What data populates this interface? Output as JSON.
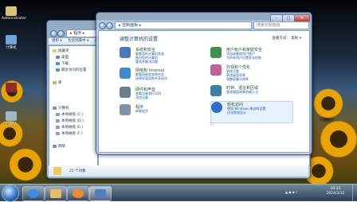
{
  "desktop": {
    "icons": [
      {
        "label": "Administrator",
        "color": "#d9c27a"
      },
      {
        "label": "计算机",
        "color": "#6fa5d8"
      },
      {
        "label": "",
        "color": "#8e2b2b"
      },
      {
        "label": "回收站",
        "color": "#9fb8c8"
      }
    ]
  },
  "explorer": {
    "address": "▸ 程序 ▸",
    "search_placeholder": "搜索",
    "toolbar": [
      "组织 ▾",
      "包含到库中 ▾",
      "共享 ▾",
      "新建文件夹"
    ],
    "tree": [
      {
        "label": "收藏夹",
        "color": "#f2c45a"
      },
      {
        "label": "桌面",
        "color": "#5b8ed0"
      },
      {
        "label": "下载",
        "color": "#5b8ed0"
      },
      {
        "label": "最近访问的位置",
        "color": "#5b8ed0"
      },
      {
        "label": "",
        "color": "#ffffff"
      },
      {
        "label": "库",
        "color": "#e0b050"
      },
      {
        "label": "",
        "color": "#ffffff"
      },
      {
        "label": "计算机",
        "color": "#6f95c0"
      },
      {
        "label": "本地磁盘 (C:)",
        "color": "#8aa0b8"
      },
      {
        "label": "本地磁盘 (D:)",
        "color": "#8aa0b8"
      },
      {
        "label": "本地磁盘 (E:)",
        "color": "#8aa0b8"
      },
      {
        "label": "本地磁盘 (F:)",
        "color": "#8aa0b8"
      },
      {
        "label": "",
        "color": "#ffffff"
      },
      {
        "label": "网络",
        "color": "#6f95c0"
      }
    ],
    "status": "25 个对象"
  },
  "control_panel": {
    "address": "▸ 控制面板 ▸",
    "search_placeholder": "搜索控制面板",
    "heading": "调整计算机的设置",
    "view_by": "查看方式： 类别 ▾",
    "categories": [
      {
        "title": "系统和安全",
        "links": [
          "查看您的计算机状态",
          "备份您的计算机",
          "查找并解决问题"
        ],
        "color": "#4a78b8"
      },
      {
        "title": "网络和 Internet",
        "links": [
          "查看网络状态和任务",
          "选择家庭组和共享选项"
        ],
        "color": "#3d8ad0"
      },
      {
        "title": "硬件和声音",
        "links": [
          "查看设备和打印机",
          "添加设备"
        ],
        "color": "#6c7d8c"
      },
      {
        "title": "程序",
        "links": [
          "卸载程序"
        ],
        "color": "#7f93a8"
      },
      {
        "title": "用户帐户和家庭安全",
        "links": [
          "添加或删除用户帐户",
          "为所有用户设置家长控制"
        ],
        "color": "#3f8f4f"
      },
      {
        "title": "外观和个性化",
        "links": [
          "更改主题",
          "更改桌面背景",
          "调整屏幕分辨率"
        ],
        "color": "#c55f9a"
      },
      {
        "title": "时钟、语言和区域",
        "links": [
          "更改键盘或其他输入法"
        ],
        "color": "#3e7fa8"
      },
      {
        "title": "轻松访问",
        "links": [
          "使用 Windows 建议的设置",
          "优化视频显示"
        ],
        "color": "#2d6fc4"
      }
    ]
  },
  "taskbar": {
    "buttons": [
      {
        "name": "ie",
        "color": "#3a8de0"
      },
      {
        "name": "explorer",
        "color": "#e6c060"
      },
      {
        "name": "media",
        "color": "#f08a2a"
      },
      {
        "name": "control-panel",
        "color": "#4c7fc0"
      }
    ],
    "time": "10:33",
    "date": "2014/3/12"
  }
}
